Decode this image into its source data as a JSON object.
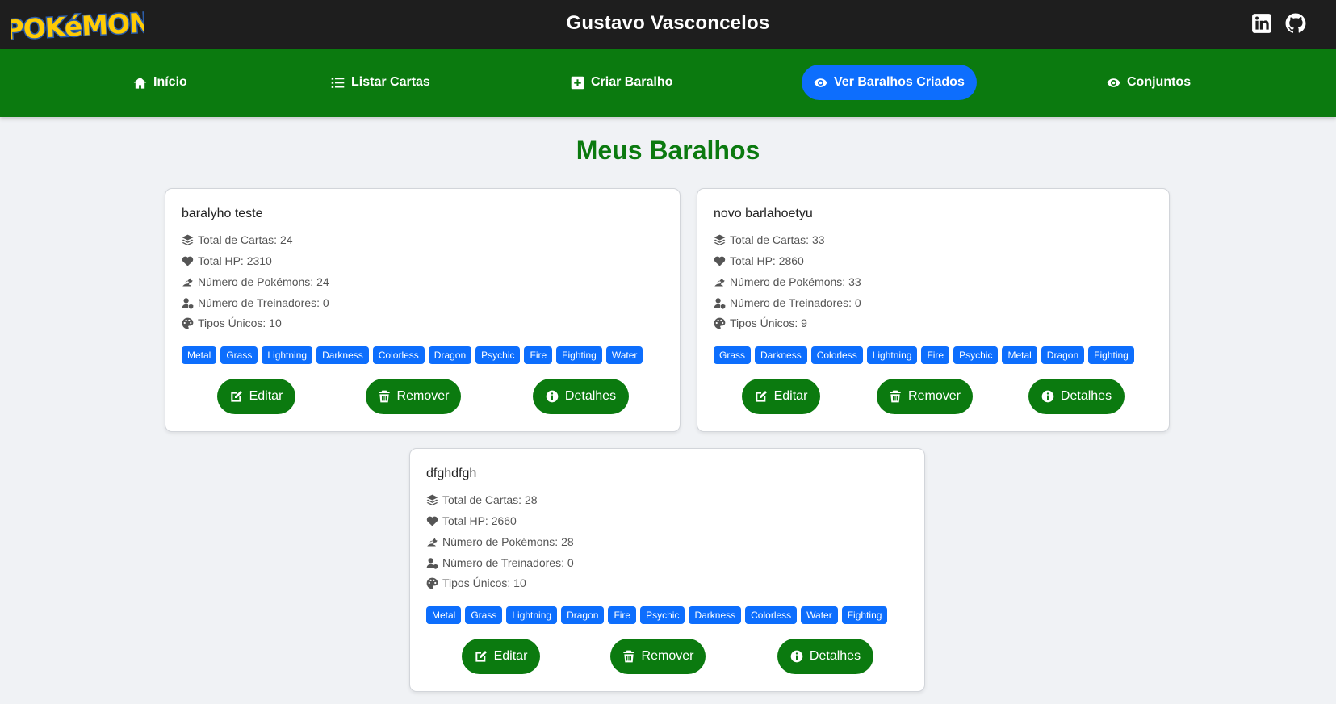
{
  "header": {
    "logo_text": "POKéMON",
    "title": "Gustavo Vasconcelos",
    "social": [
      {
        "icon": "linkedin-icon"
      },
      {
        "icon": "github-icon"
      }
    ]
  },
  "nav": {
    "items": [
      {
        "label": "Início",
        "icon": "home-icon"
      },
      {
        "label": "Listar Cartas",
        "icon": "list-icon"
      },
      {
        "label": "Criar Baralho",
        "icon": "plus-square-icon"
      },
      {
        "label": "Ver Baralhos Criados",
        "icon": "eye-icon",
        "active": true
      },
      {
        "label": "Conjuntos",
        "icon": "eye-icon"
      }
    ]
  },
  "page": {
    "title": "Meus Baralhos"
  },
  "colors": {
    "topbar": "#1e1e1e",
    "nav": "#0b7a0f",
    "accent": "#0d6efd",
    "button": "#0b7a0f",
    "heading": "#0b7a0f"
  },
  "decks": [
    {
      "name": "baralyho teste",
      "total_cards": "Total de Cartas: 24",
      "total_hp": "Total HP: 2310",
      "num_pokemons": "Número de Pokémons: 24",
      "num_trainers": "Número de Treinadores: 0",
      "unique_types": "Tipos Únicos: 10",
      "types": [
        "Metal",
        "Grass",
        "Lightning",
        "Darkness",
        "Colorless",
        "Dragon",
        "Psychic",
        "Fire",
        "Fighting",
        "Water"
      ]
    },
    {
      "name": "novo barlahoetyu",
      "total_cards": "Total de Cartas: 33",
      "total_hp": "Total HP: 2860",
      "num_pokemons": "Número de Pokémons: 33",
      "num_trainers": "Número de Treinadores: 0",
      "unique_types": "Tipos Únicos: 9",
      "types": [
        "Grass",
        "Darkness",
        "Colorless",
        "Lightning",
        "Fire",
        "Psychic",
        "Metal",
        "Dragon",
        "Fighting"
      ]
    },
    {
      "name": "dfghdfgh",
      "total_cards": "Total de Cartas: 28",
      "total_hp": "Total HP: 2660",
      "num_pokemons": "Número de Pokémons: 28",
      "num_trainers": "Número de Treinadores: 0",
      "unique_types": "Tipos Únicos: 10",
      "types": [
        "Metal",
        "Grass",
        "Lightning",
        "Dragon",
        "Fire",
        "Psychic",
        "Darkness",
        "Colorless",
        "Water",
        "Fighting"
      ]
    }
  ],
  "card_buttons": {
    "edit": "Editar",
    "remove": "Remover",
    "details": "Detalhes"
  }
}
